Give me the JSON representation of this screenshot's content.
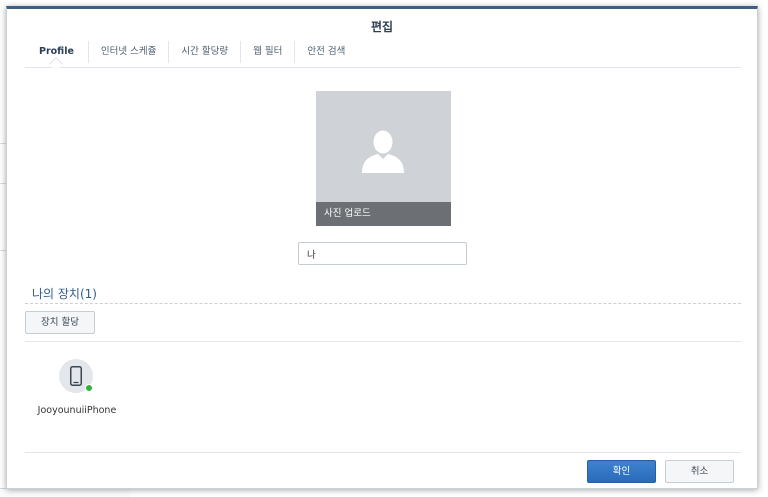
{
  "dialog": {
    "title": "편집"
  },
  "tabs": [
    {
      "label": "Profile"
    },
    {
      "label": "인터넷 스케쥴"
    },
    {
      "label": "시간 할당량"
    },
    {
      "label": "웹 필터"
    },
    {
      "label": "안전 검색"
    }
  ],
  "profile": {
    "photo_upload_label": "사진 업로드",
    "photo_icon": "user-silhouette-icon",
    "name_value": "나"
  },
  "devices_section": {
    "title": "나의 장치(1)",
    "assign_button_label": "장치 할당",
    "devices": [
      {
        "name": "JooyounuiiPhone",
        "icon": "smartphone-icon",
        "status": "online"
      }
    ]
  },
  "footer": {
    "ok_label": "확인",
    "cancel_label": "취소"
  },
  "colors": {
    "accent": "#3c5f86",
    "primary_button": "#2f74c4",
    "online_status": "#2fb534",
    "section_title": "#2f5d8f"
  }
}
